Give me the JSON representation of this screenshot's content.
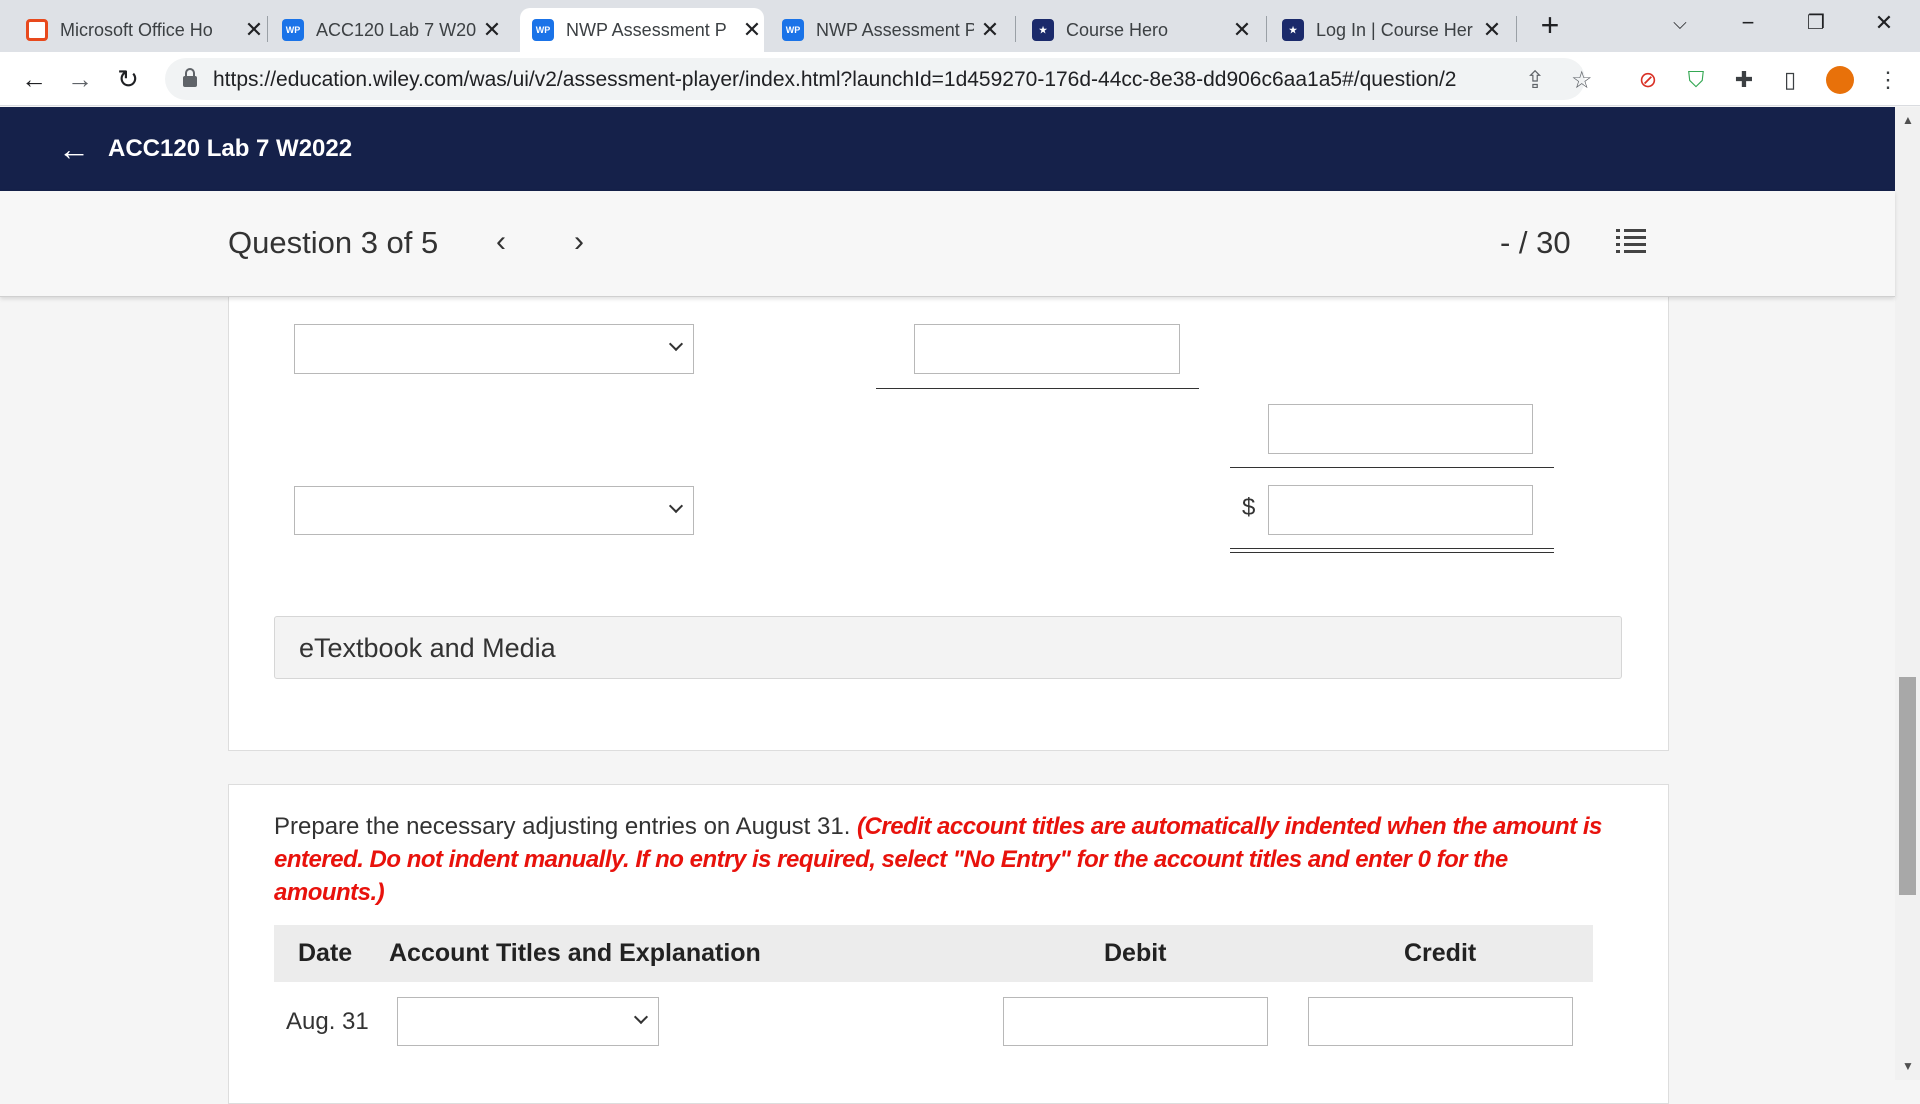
{
  "browser": {
    "tabs": [
      {
        "title": "Microsoft Office Ho",
        "favicon": "office-icon",
        "active": false
      },
      {
        "title": "ACC120 Lab 7 W20",
        "favicon": "wp-icon",
        "active": false
      },
      {
        "title": "NWP Assessment P",
        "favicon": "wp-icon",
        "active": true
      },
      {
        "title": "NWP Assessment P",
        "favicon": "wp-icon",
        "active": false
      },
      {
        "title": "Course Hero",
        "favicon": "course-hero-icon",
        "active": false
      },
      {
        "title": "Log In | Course Her",
        "favicon": "course-hero-icon",
        "active": false
      }
    ],
    "wp_favicon_text": "WP",
    "url": "https://education.wiley.com/was/ui/v2/assessment-player/index.html?launchId=1d459270-176d-44cc-8e38-dd906c6aa1a5#/question/2"
  },
  "app": {
    "header_title": "ACC120 Lab 7 W2022",
    "question_label": "Question 3 of 5",
    "score": "- / 30"
  },
  "card1": {
    "dollar_sign": "$",
    "etextbook_label": "eTextbook and Media"
  },
  "card2": {
    "prompt_plain": "Prepare the necessary adjusting entries on August 31. ",
    "prompt_red": "(Credit account titles are automatically indented when the amount is entered. Do not indent manually. If no entry is required, select \"No Entry\" for the account titles and enter 0 for the amounts.)",
    "table": {
      "headers": {
        "date": "Date",
        "account": "Account Titles and Explanation",
        "debit": "Debit",
        "credit": "Credit"
      },
      "rows": [
        {
          "date": "Aug. 31"
        }
      ]
    }
  },
  "colors": {
    "app_header": "#15214a",
    "instruction_red": "#e8120c",
    "tab_bar": "#dee1e6"
  }
}
